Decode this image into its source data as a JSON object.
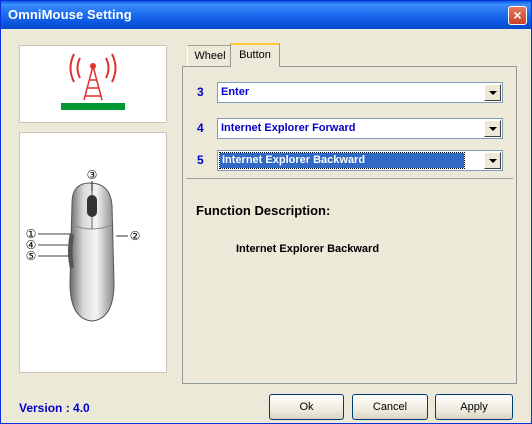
{
  "window": {
    "title": "OmniMouse Setting",
    "close_glyph": "×"
  },
  "version_text": "Version : 4.0",
  "tabs": [
    {
      "label": "Wheel",
      "active": false
    },
    {
      "label": "Button",
      "active": true
    }
  ],
  "button_mappings": [
    {
      "number": "3",
      "value": "Enter"
    },
    {
      "number": "4",
      "value": "Internet Explorer Forward"
    },
    {
      "number": "5",
      "value": "Internet Explorer Backward"
    }
  ],
  "mouse_button_labels": [
    "①",
    "②",
    "③",
    "④",
    "⑤"
  ],
  "function_description": {
    "title": "Function Description:",
    "text": "Internet Explorer Backward"
  },
  "buttons": {
    "ok": "Ok",
    "cancel": "Cancel",
    "apply": "Apply"
  },
  "colors": {
    "titlebar": "#0a54db",
    "accent_text": "#0000c8",
    "selection": "#316ac5",
    "tower_red": "#e03030",
    "tower_green": "#009933"
  }
}
